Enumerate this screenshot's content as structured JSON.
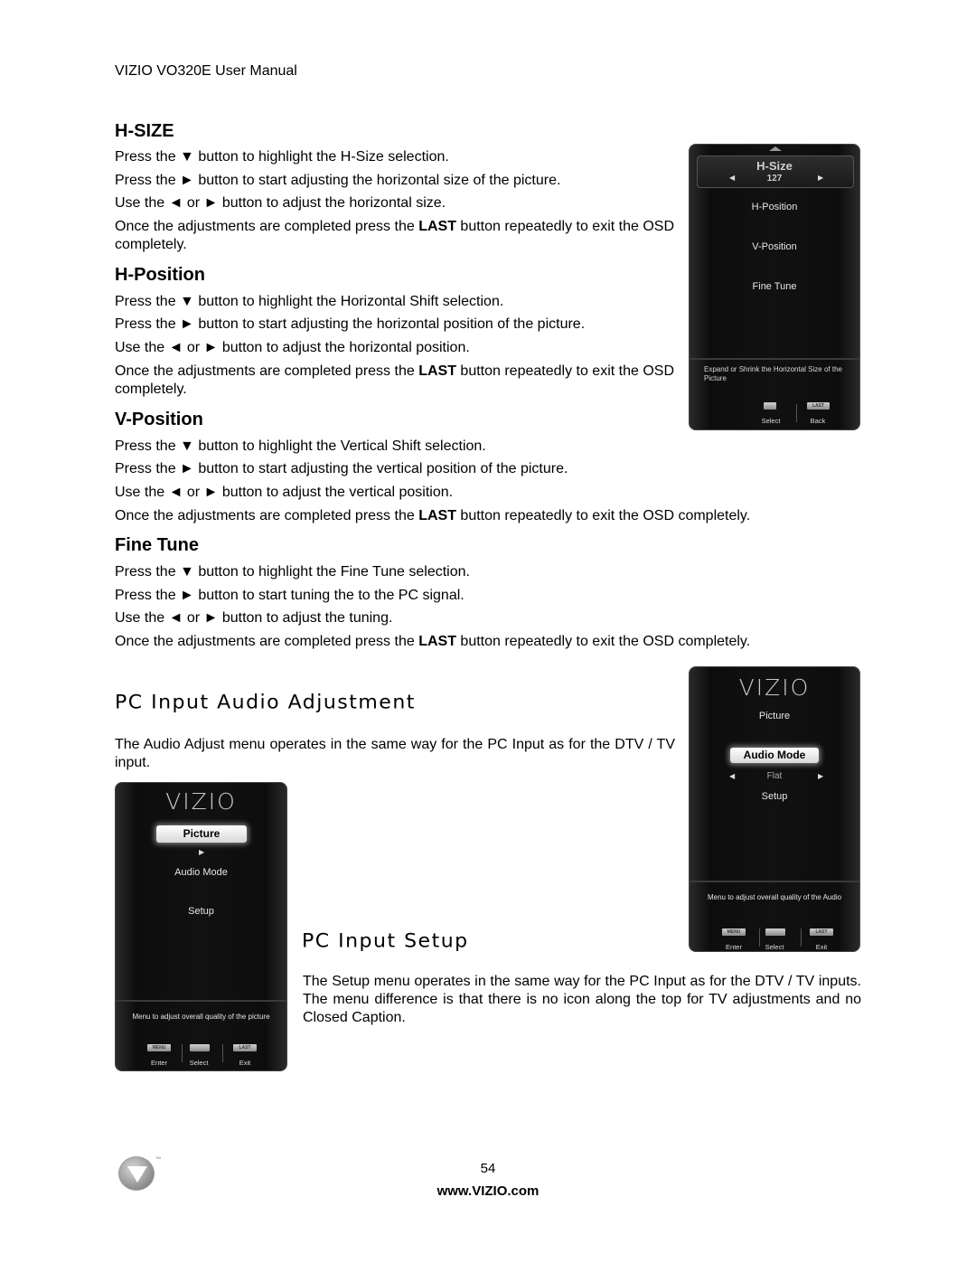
{
  "header": {
    "title": "VIZIO VO320E User Manual"
  },
  "sections": {
    "hsize": {
      "heading": "H-SIZE",
      "lines": [
        "Press the ▼ button to highlight the H-Size selection.",
        "Press the  ► button to start adjusting the horizontal size of the picture.",
        "Use the ◄ or ► button to adjust the horizontal size."
      ],
      "last_pre": "Once the adjustments are completed press the ",
      "last_bold": "LAST",
      "last_post": " button repeatedly to exit the OSD completely."
    },
    "hposition": {
      "heading": "H-Position",
      "lines": [
        "Press the ▼ button to highlight the Horizontal Shift selection.",
        "Press the ► button to start adjusting the horizontal position of the picture.",
        "Use the ◄ or ► button to adjust the horizontal position."
      ],
      "last_pre": "Once the adjustments are completed press the ",
      "last_bold": "LAST",
      "last_post": " button repeatedly to exit the OSD completely."
    },
    "vposition": {
      "heading": "V-Position",
      "lines": [
        "Press the ▼ button to highlight the Vertical Shift selection.",
        "Press the  ►  button to start adjusting the vertical position of the picture.",
        "Use the ◄ or ► button to adjust the vertical position."
      ],
      "last_pre": "Once the adjustments are completed press the ",
      "last_bold": "LAST",
      "last_post": " button repeatedly to exit the OSD completely."
    },
    "finetune": {
      "heading": "Fine Tune",
      "lines": [
        "Press the  ▼ button to highlight the Fine Tune selection.",
        "Press the  ► button to start tuning the to the PC signal.",
        "Use the ◄ or ► button to adjust the tuning."
      ],
      "last_pre": "Once the adjustments are completed press the ",
      "last_bold": "LAST",
      "last_post": " button repeatedly to exit the OSD completely."
    },
    "audio": {
      "heading": "PC Input Audio Adjustment",
      "body": "The Audio Adjust menu operates in the same way for the PC Input as for the DTV / TV input."
    },
    "setup": {
      "heading": "PC Input Setup",
      "body": "The Setup menu operates in the same way for the PC Input as for the DTV / TV inputs.  The menu difference is that there is no icon along the top for TV adjustments and no Closed Caption."
    }
  },
  "osd_hsize": {
    "selected_label": "H-Size",
    "selected_value": "127",
    "items": [
      "H-Position",
      "V-Position",
      "Fine Tune"
    ],
    "description": "Expand or Shrink the Horizontal Size of the Picture",
    "buttons": [
      {
        "key": "◄►▲▼",
        "label": "Select"
      },
      {
        "key": "LAST",
        "label": "Back"
      }
    ]
  },
  "osd_audio": {
    "logo": "VIZIO",
    "items": [
      "Picture",
      "Audio Mode",
      "Setup"
    ],
    "selected_item": "Audio Mode",
    "selected_value": "Flat",
    "description": "Menu to adjust overall quality of the Audio",
    "buttons": [
      {
        "key": "MENU",
        "label": "Enter"
      },
      {
        "key": "◄►▲▼",
        "label": "Select"
      },
      {
        "key": "LAST",
        "label": "Exit"
      }
    ]
  },
  "osd_picture": {
    "logo": "VIZIO",
    "items": [
      "Picture",
      "Audio Mode",
      "Setup"
    ],
    "selected_item": "Picture",
    "description": "Menu to adjust overall quality of the picture",
    "buttons": [
      {
        "key": "MENU",
        "label": "Enter"
      },
      {
        "key": "◄►▲▼",
        "label": "Select"
      },
      {
        "key": "LAST",
        "label": "Exit"
      }
    ]
  },
  "footer": {
    "page_number": "54",
    "url": "www.VIZIO.com",
    "trademark": "TM"
  }
}
